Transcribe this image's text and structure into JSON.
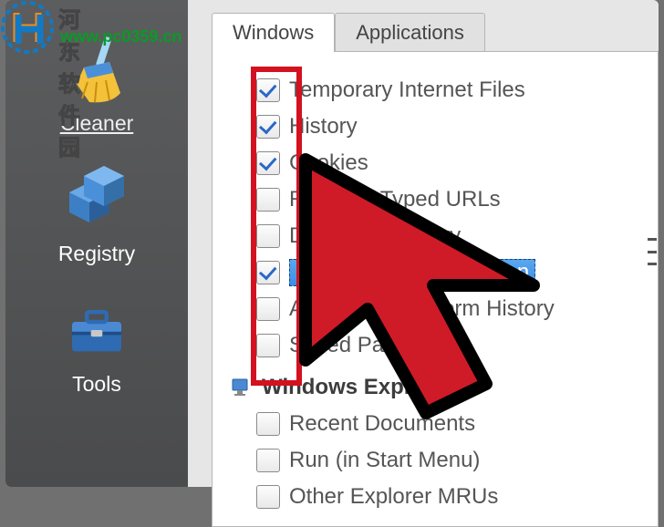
{
  "watermark": {
    "text": "河东软件园",
    "url": "www.pc0359.cn"
  },
  "sidebar": {
    "items": [
      {
        "label": "Cleaner",
        "active": true,
        "icon": "broom"
      },
      {
        "label": "Registry",
        "active": false,
        "icon": "registry"
      },
      {
        "label": "Tools",
        "active": false,
        "icon": "toolbox"
      }
    ]
  },
  "tabs": [
    {
      "label": "Windows",
      "active": true
    },
    {
      "label": "Applications",
      "active": false
    }
  ],
  "checklist": [
    {
      "label": "Temporary Internet Files",
      "checked": true
    },
    {
      "label": "History",
      "checked": true
    },
    {
      "label": "Cookies",
      "checked": true
    },
    {
      "label": "Recently Typed URLs",
      "checked": false
    },
    {
      "label": "Download History",
      "checked": false
    },
    {
      "label": "Last Download Location",
      "checked": true,
      "selected": true
    },
    {
      "label": "Autocomplete Form History",
      "checked": false
    },
    {
      "label": "Saved Passwords",
      "checked": false
    }
  ],
  "section2": {
    "heading": "Windows Explorer",
    "items": [
      {
        "label": "Recent Documents",
        "checked": false
      },
      {
        "label": "Run (in Start Menu)",
        "checked": false
      },
      {
        "label": "Other Explorer MRUs",
        "checked": false
      }
    ]
  }
}
